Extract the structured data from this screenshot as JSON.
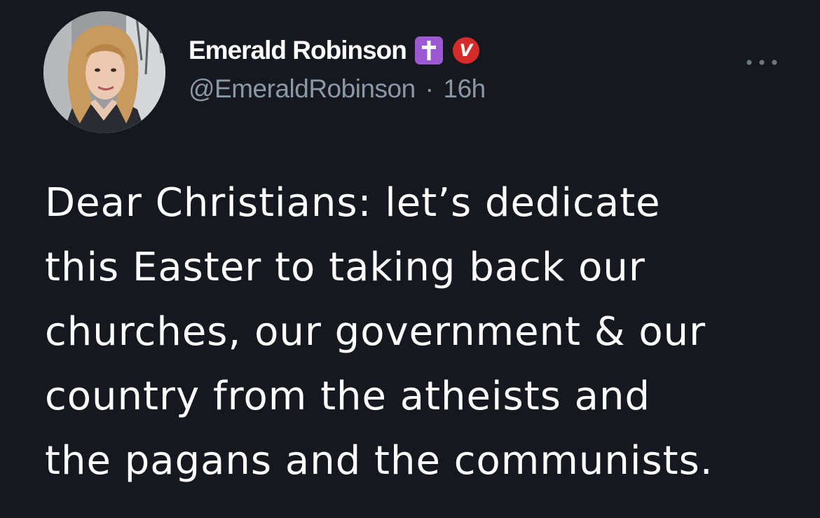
{
  "tweet": {
    "author": {
      "display_name": "Emerald Robinson",
      "handle": "@EmeraldRobinson",
      "separator": "·",
      "timestamp": "16h",
      "name_badge_icon": "latin-cross-icon",
      "verified_badge_letter": "V"
    },
    "more_icon": "ellipsis-icon",
    "text": "Dear Christians: let’s dedicate\nthis Easter to taking back our\nchurches, our government & our\ncountry from the atheists and\nthe pagans and the communists."
  },
  "colors": {
    "background": "#15181f",
    "text": "#ffffff",
    "secondary_text": "#8b98a5",
    "cross_badge": "#9c59d1",
    "verified_badge": "#d62b2b"
  }
}
